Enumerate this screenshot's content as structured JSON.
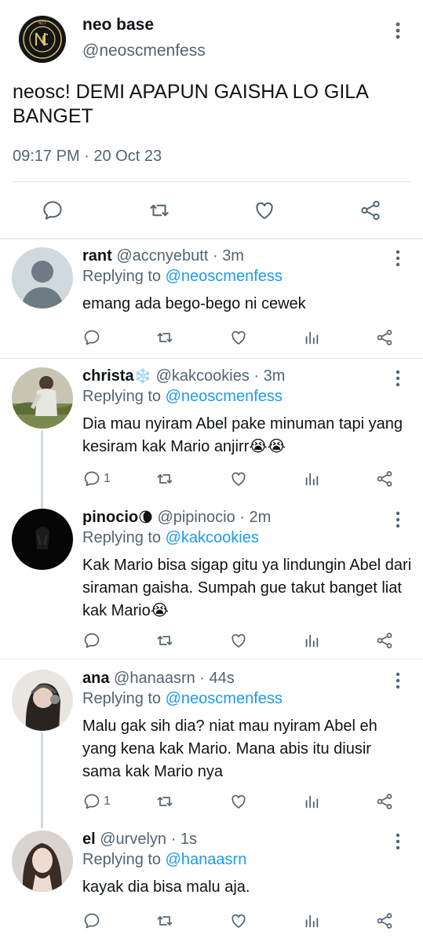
{
  "main_tweet": {
    "name": "neo base",
    "handle": "@neoscmenfess",
    "text": "neosc! DEMI APAPUN GAISHA LO GILA BANGET",
    "timestamp": "09:17 PM · 20 Oct 23",
    "avatar_logo_text": "NCT",
    "actions": [
      "reply-icon",
      "retweet-icon",
      "like-icon",
      "share-icon"
    ]
  },
  "replies": [
    {
      "name": "rant",
      "name_emoji": "",
      "handle": "@accnyebutt",
      "time": "3m",
      "replying_label": "Replying to",
      "replying_to": "@neoscmenfess",
      "text": "emang ada bego-bego ni cewek",
      "reply_count": ""
    },
    {
      "name": "christa",
      "name_emoji": "❄️",
      "handle": "@kakcookies",
      "time": "3m",
      "replying_label": "Replying to",
      "replying_to": "@neoscmenfess",
      "text": "Dia mau nyiram Abel pake minuman tapi yang kesiram kak Mario anjirr😭😭",
      "reply_count": "1"
    },
    {
      "name": "pinocio",
      "name_emoji": "🌘",
      "handle": "@pipinocio",
      "time": "2m",
      "replying_label": "Replying to",
      "replying_to": "@kakcookies",
      "text": "Kak Mario bisa sigap gitu ya lindungin Abel dari siraman gaisha. Sumpah gue takut banget liat kak Mario😭",
      "reply_count": ""
    },
    {
      "name": "ana",
      "name_emoji": "",
      "handle": "@hanaasrn",
      "time": "44s",
      "replying_label": "Replying to",
      "replying_to": "@neoscmenfess",
      "text": "Malu gak sih dia? niat mau nyiram Abel eh yang kena kak Mario. Mana abis itu diusir sama kak Mario nya",
      "reply_count": "1"
    },
    {
      "name": "el",
      "name_emoji": "",
      "handle": "@urvelyn",
      "time": "1s",
      "replying_label": "Replying to",
      "replying_to": "@hanaasrn",
      "text": "kayak dia bisa malu aja.",
      "reply_count": ""
    }
  ],
  "separator": "·",
  "colors": {
    "text": "#0f1419",
    "secondary": "#536471",
    "link": "#1d9bf0",
    "divider": "#e6eaed",
    "thread_line": "#cfd9de"
  }
}
